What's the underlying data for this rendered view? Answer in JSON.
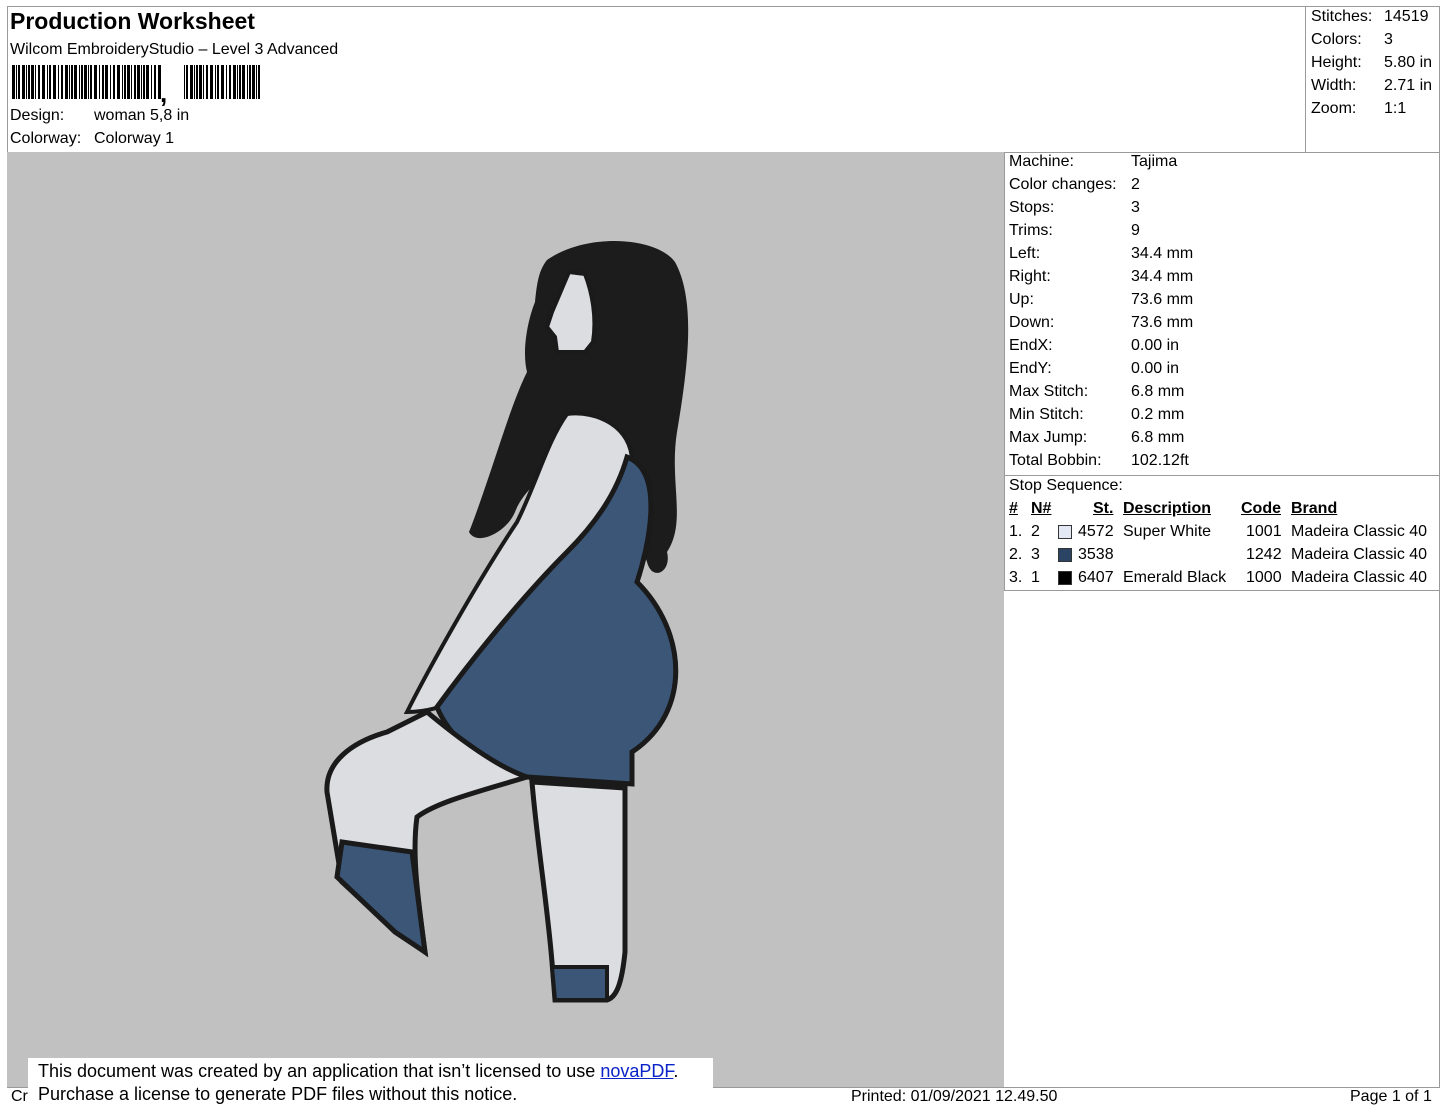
{
  "header": {
    "title": "Production Worksheet",
    "software": "Wilcom EmbroideryStudio – Level 3 Advanced",
    "barcode_text": ",",
    "design_label": "Design:",
    "design_value": "woman 5,8 in",
    "colorway_label": "Colorway:",
    "colorway_value": "Colorway 1"
  },
  "summary": [
    {
      "label": "Stitches:",
      "value": "14519"
    },
    {
      "label": "Colors:",
      "value": "3"
    },
    {
      "label": "Height:",
      "value": "5.80 in"
    },
    {
      "label": "Width:",
      "value": "2.71 in"
    },
    {
      "label": "Zoom:",
      "value": "1:1"
    }
  ],
  "machine_stats": [
    {
      "label": "Machine:",
      "value": "Tajima"
    },
    {
      "label": "Color changes:",
      "value": "2"
    },
    {
      "label": "Stops:",
      "value": "3"
    },
    {
      "label": "Trims:",
      "value": "9"
    },
    {
      "label": "Left:",
      "value": "34.4 mm"
    },
    {
      "label": "Right:",
      "value": "34.4 mm"
    },
    {
      "label": "Up:",
      "value": "73.6 mm"
    },
    {
      "label": "Down:",
      "value": "73.6 mm"
    },
    {
      "label": "EndX:",
      "value": "0.00 in"
    },
    {
      "label": "EndY:",
      "value": "0.00 in"
    },
    {
      "label": "Max Stitch:",
      "value": "6.8 mm"
    },
    {
      "label": "Min Stitch:",
      "value": "0.2 mm"
    },
    {
      "label": "Max Jump:",
      "value": "6.8 mm"
    },
    {
      "label": "Total Bobbin:",
      "value": "102.12ft"
    }
  ],
  "stop_sequence": {
    "title": "Stop Sequence:",
    "headers": {
      "num": "#",
      "n": "N#",
      "st": "St.",
      "description": "Description",
      "code": "Code",
      "brand": "Brand"
    },
    "rows": [
      {
        "num": "1.",
        "n": "2",
        "color": "#e4e7f4",
        "st": "4572",
        "description": "Super White",
        "code": "1001",
        "brand": "Madeira Classic 40"
      },
      {
        "num": "2.",
        "n": "3",
        "color": "#2c4463",
        "st": "3538",
        "description": "",
        "code": "1242",
        "brand": "Madeira Classic 40"
      },
      {
        "num": "3.",
        "n": "1",
        "color": "#000000",
        "st": "6407",
        "description": "Emerald Black",
        "code": "1000",
        "brand": "Madeira Classic 40"
      }
    ]
  },
  "notice": {
    "line1_prefix": "This document was created by an application that isn’t licensed to use ",
    "link": "novaPDF",
    "line1_suffix": ".",
    "line2": "Purchase a license to generate PDF files without this notice."
  },
  "footer": {
    "left_text": "Cr",
    "printed": "Printed: 01/09/2021 12.49.50",
    "page": "Page 1 of 1"
  },
  "colors": {
    "canvas_bg": "#c1c1c1",
    "hair": "#1c1c1c",
    "skin": "#dcdde0",
    "dress": "#3b5677",
    "outline": "#1a1a1a"
  }
}
